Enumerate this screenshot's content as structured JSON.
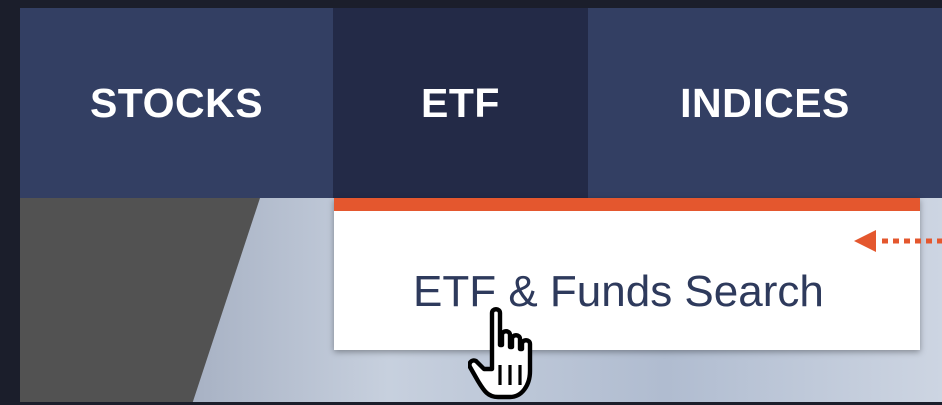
{
  "nav": {
    "items": [
      {
        "label": "STOCKS"
      },
      {
        "label": "ETF"
      },
      {
        "label": "INDICES"
      }
    ]
  },
  "dropdown": {
    "item_label": "ETF & Funds Search"
  },
  "colors": {
    "navbar": "#333f63",
    "navbar_active": "#232a47",
    "accent": "#e4572e",
    "dropdown_text": "#2e3a5c"
  },
  "icons": {
    "cursor": "hand-pointer-icon",
    "annotation": "dotted-arrow-left-icon"
  }
}
